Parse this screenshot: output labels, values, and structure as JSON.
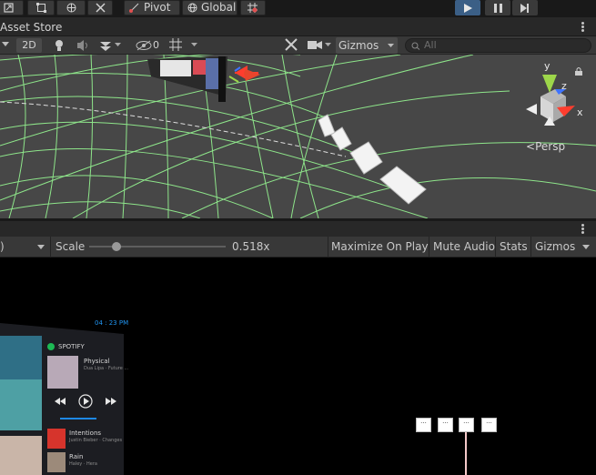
{
  "top_toolbar": {
    "pivot_label": "Pivot",
    "global_label": "Global",
    "play_accent": "#3b5f86"
  },
  "scene_tab": {
    "label": "Asset Store"
  },
  "scene_toolbar": {
    "mode_2d": "2D",
    "hidden_count": "0",
    "gizmos_label": "Gizmos",
    "search_placeholder": "All"
  },
  "scene_view": {
    "grid_color": "#8ee58a",
    "background": "#474747",
    "orientation": {
      "label": "Persp",
      "y": "y",
      "z": "z",
      "x": "x"
    }
  },
  "game_toolbar": {
    "scale_label": "Scale",
    "scale_value": "0.518x",
    "maximize_label": "Maximize On Play",
    "mute_label": "Mute Audio",
    "stats_label": "Stats",
    "gizmos_label": "Gizmos",
    "scale_fraction": 0.17
  },
  "game_view": {
    "time": "04 : 23 PM",
    "spotify": {
      "app": "SPOTIFY",
      "track_title": "Physical",
      "track_artist": "Dua Lipa · Future ...",
      "queue": [
        {
          "title": "Intentions",
          "artist": "Justin Bieber · Changes"
        },
        {
          "title": "Rain",
          "artist": "Haley · Hera"
        }
      ]
    },
    "mini_cards": [
      "···",
      "···",
      "···",
      "···"
    ]
  }
}
